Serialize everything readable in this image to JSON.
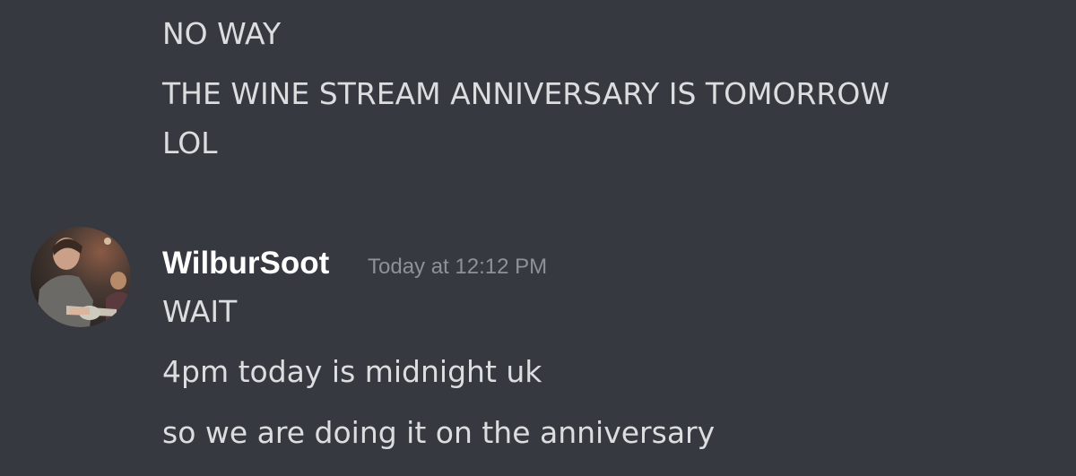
{
  "previous_messages": {
    "lines": [
      "NO WAY",
      "THE WINE STREAM ANNIVERSARY IS TOMORROW",
      "LOL"
    ]
  },
  "message_group": {
    "username": "WilburSoot",
    "timestamp": "Today at 12:12 PM",
    "avatar_icon": "user-avatar-photo",
    "lines": [
      "WAIT",
      "4pm today is midnight uk",
      "so we are doing it on the anniversary"
    ]
  },
  "colors": {
    "background": "#36393f",
    "text": "#dcddde",
    "username": "#ffffff",
    "timestamp": "#8e9297"
  }
}
